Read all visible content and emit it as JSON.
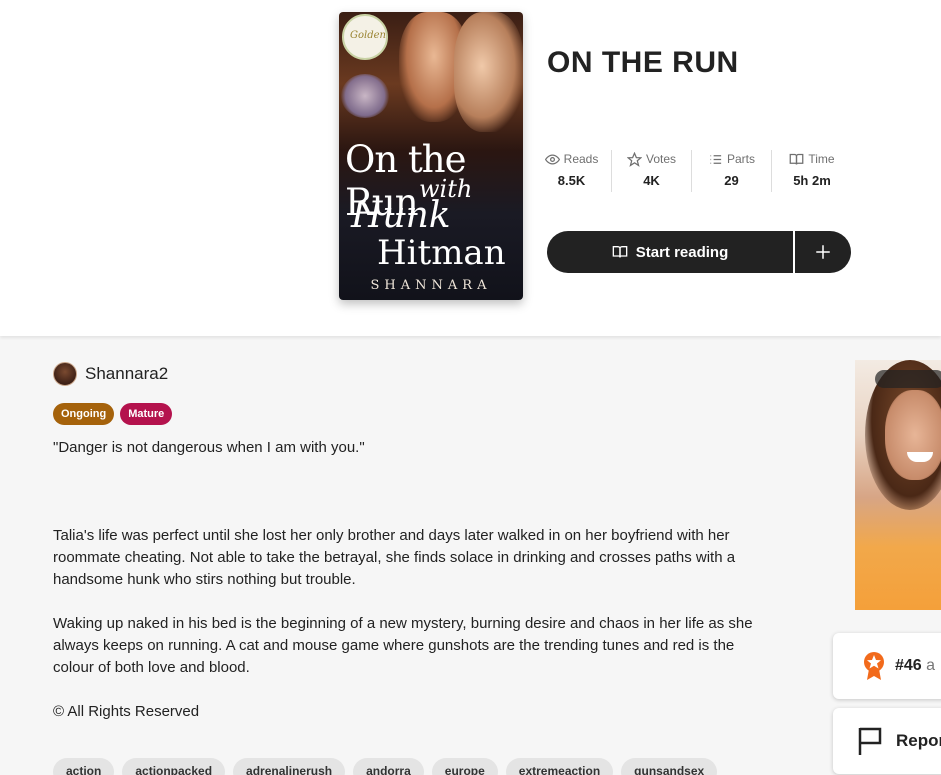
{
  "story": {
    "title": "ON THE RUN",
    "cover": {
      "badge_text": "Golden",
      "title_line1": "On the Run",
      "title_line2": "with",
      "title_line3": "Hunk",
      "title_line4": "Hitman",
      "author": "SHANNARA"
    }
  },
  "stats": [
    {
      "label": "Reads",
      "value": "8.5K",
      "icon": "eye-icon"
    },
    {
      "label": "Votes",
      "value": "4K",
      "icon": "star-icon"
    },
    {
      "label": "Parts",
      "value": "29",
      "icon": "list-icon"
    },
    {
      "label": "Time",
      "value": "5h 2m",
      "icon": "book-icon"
    }
  ],
  "actions": {
    "start_reading": "Start reading",
    "add_icon": "plus-icon"
  },
  "author": {
    "name": "Shannara2"
  },
  "status_tags": {
    "ongoing": "Ongoing",
    "mature": "Mature"
  },
  "description": {
    "tagline": "\"Danger is not dangerous when I am with you.\"",
    "paragraph1": "Talia's life was perfect until she lost her only brother and days later walked in on her boyfriend with her roommate cheating. Not able to take the betrayal, she finds solace in drinking and crosses paths with a handsome hunk who stirs nothing but trouble.",
    "paragraph2": "Waking up naked in his bed is the beginning of a new mystery, burning desire and chaos in her life as she always keeps on running. A cat and mouse game where gunshots are the trending tunes and red is the colour of both love and blood.",
    "rights": "© All Rights Reserved"
  },
  "tags": [
    "action",
    "actionpacked",
    "adrenalinerush",
    "andorra",
    "europe",
    "extremeaction",
    "gunsandsex"
  ],
  "rank": {
    "number": "#46",
    "suffix": "a"
  },
  "report": {
    "label": "Report"
  },
  "colors": {
    "ongoing": "#a5620b",
    "mature": "#b4124d",
    "button": "#222222",
    "rank_icon": "#f26a1b"
  }
}
